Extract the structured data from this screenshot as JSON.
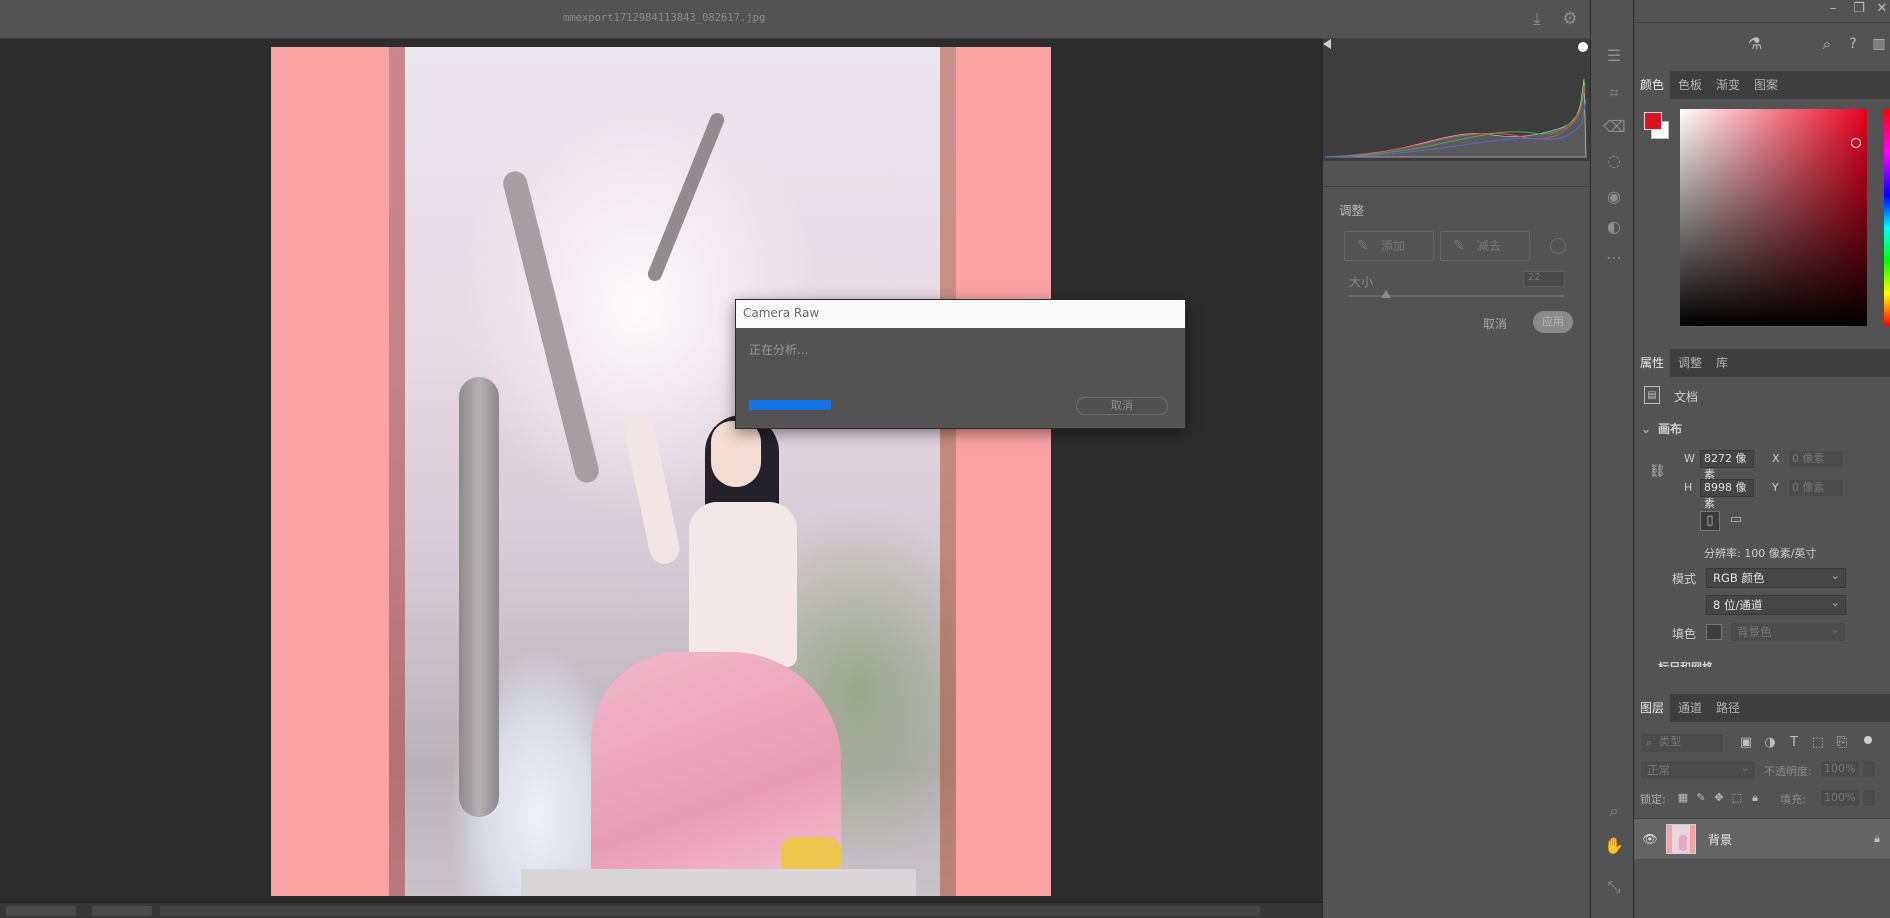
{
  "camera_raw": {
    "filename": "mmexport1712984113843_082617.jpg",
    "title_icons": [
      "save-icon",
      "gear-icon",
      "fullscreen-icon"
    ],
    "dialog": {
      "title": "Camera Raw",
      "message": "正在分析...",
      "progress": 0.22,
      "cancel_label": "取消"
    },
    "panel": {
      "adjust_title": "调整",
      "add_label": "添加",
      "subtract_label": "减去",
      "size_label": "大小",
      "size_value": "22",
      "size_slider": 0.17,
      "cancel_label": "取消",
      "apply_label": "应用"
    },
    "tools": [
      "edit-sliders-icon",
      "crop-icon",
      "eraser-icon",
      "mask-icon",
      "red-eye-icon",
      "presets-icon",
      "more-icon",
      "zoom-icon",
      "hand-icon",
      "eyedropper-icon"
    ]
  },
  "photoshop": {
    "top_icons": [
      "minimize-icon",
      "restore-icon",
      "close-icon",
      "flask-icon",
      "search-icon",
      "help-icon",
      "panel-icon"
    ],
    "color_panel": {
      "tabs": [
        "颜色",
        "色板",
        "渐变",
        "图案"
      ],
      "active_tab": 0,
      "foreground": "#d7141f",
      "background": "#ffffff",
      "hue": "#e8001e"
    },
    "properties_panel": {
      "tabs": [
        "属性",
        "调整",
        "库"
      ],
      "active_tab": 0,
      "document_label": "文档",
      "canvas_section": "画布",
      "w_label": "W",
      "w_value": "8272 像素",
      "h_label": "H",
      "h_value": "8998 像素",
      "x_label": "X",
      "x_placeholder": "0 像素",
      "y_label": "Y",
      "y_placeholder": "0 像素",
      "resolution": "分辨率: 100 像素/英寸",
      "mode_label": "模式",
      "mode_value": "RGB 颜色",
      "depth_value": "8 位/通道",
      "fill_label": "填色",
      "fill_value": "背景色",
      "next_section": "标尺和网格"
    },
    "layers_panel": {
      "tabs": [
        "图层",
        "通道",
        "路径"
      ],
      "active_tab": 0,
      "filter_placeholder": "类型",
      "blend_mode": "正常",
      "opacity_label": "不透明度:",
      "opacity_value": "100%",
      "lock_label": "锁定:",
      "fill_label": "填充:",
      "fill_value": "100%",
      "layers": [
        {
          "name": "背景",
          "visible": true,
          "locked": true
        }
      ]
    }
  }
}
